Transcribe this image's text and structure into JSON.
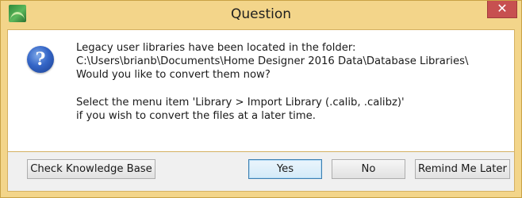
{
  "dialog": {
    "title": "Question",
    "close_label": "✕",
    "icon": "question-icon",
    "message": {
      "line1": "Legacy user libraries have been located in the folder:",
      "line2": "C:\\Users\\brianb\\Documents\\Home Designer 2016 Data\\Database Libraries\\",
      "line3": "Would you like to convert them now?",
      "line4": "Select the menu item 'Library > Import Library (.calib, .calibz)'",
      "line5": "if you wish to convert the files at a later time."
    }
  },
  "buttons": {
    "knowledge_base": "Check Knowledge Base",
    "yes": "Yes",
    "no": "No",
    "remind_later": "Remind Me Later"
  },
  "colors": {
    "frame": "#f3d58a",
    "close": "#c75050",
    "default_button_border": "#3c7fb1"
  }
}
